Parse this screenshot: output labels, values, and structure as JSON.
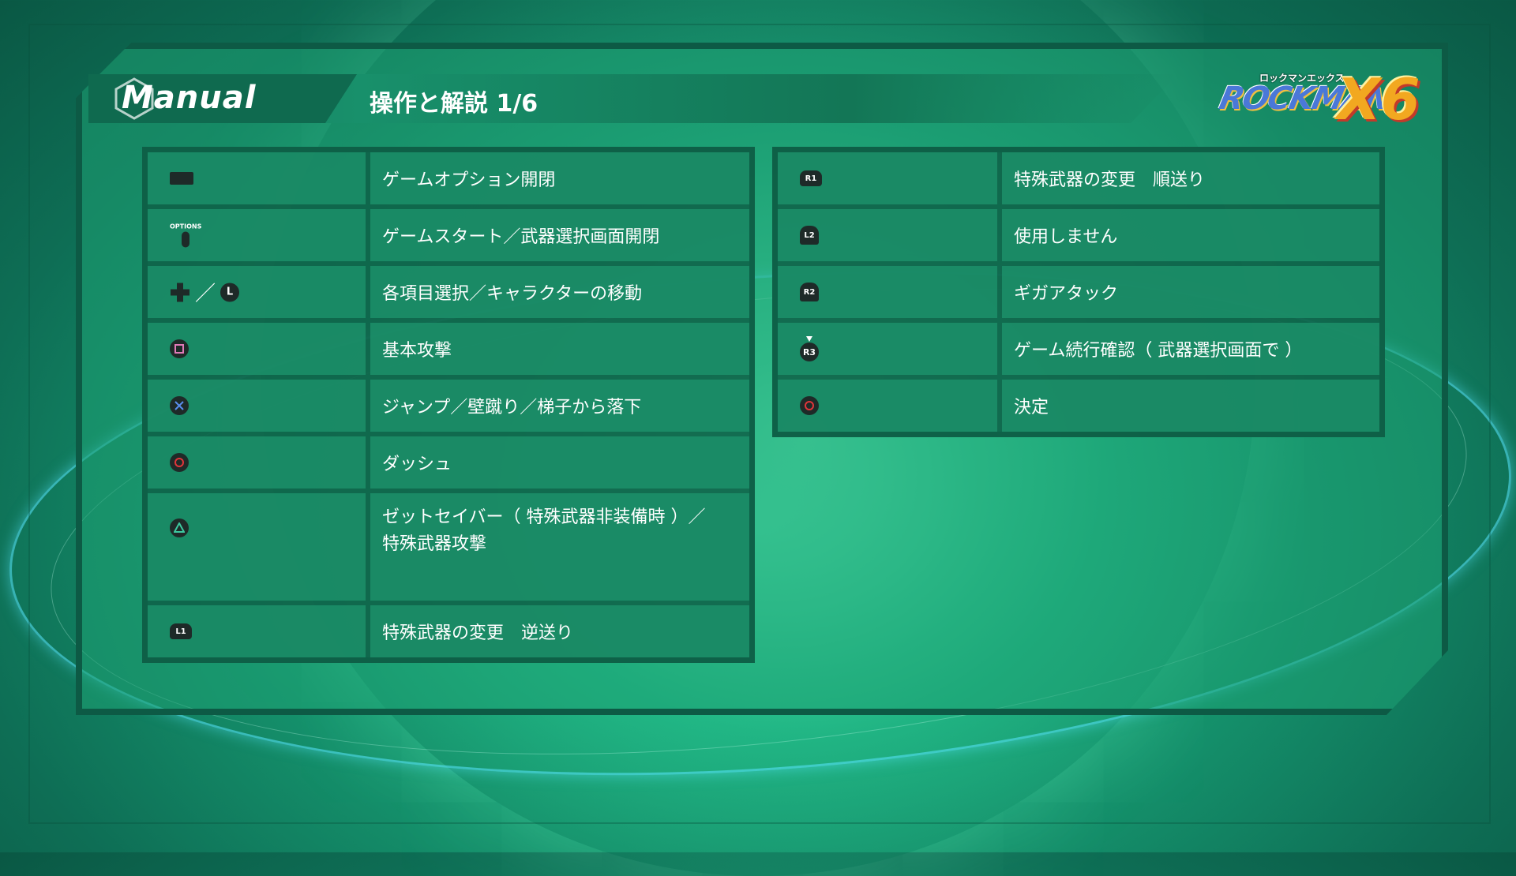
{
  "header": {
    "manual_label": "Manual",
    "page_title": "操作と解説 1/6"
  },
  "logo": {
    "kana": "ロックマンエックス",
    "rock": "ROCKMAN",
    "x6": "X6"
  },
  "left_table": [
    {
      "icon": "touchpad-icon",
      "text": "ゲームオプション開閉"
    },
    {
      "icon": "options-button-icon",
      "icon_label": "OPTIONS",
      "text": "ゲームスタート／武器選択画面開閉"
    },
    {
      "icon": "dpad-and-left-stick-icon",
      "icon_label": "L",
      "text": "各項目選択／キャラクターの移動"
    },
    {
      "icon": "square-button-icon",
      "text": "基本攻撃"
    },
    {
      "icon": "cross-button-icon",
      "text": "ジャンプ／壁蹴り／梯子から落下"
    },
    {
      "icon": "circle-button-icon",
      "text": "ダッシュ"
    },
    {
      "icon": "triangle-button-icon",
      "text_line1": "ゼットセイバー（ 特殊武器非装備時 ）／",
      "text_line2": "特殊武器攻撃"
    },
    {
      "icon": "l1-button-icon",
      "icon_label": "L1",
      "text": "特殊武器の変更　逆送り"
    }
  ],
  "right_table": [
    {
      "icon": "r1-button-icon",
      "icon_label": "R1",
      "text": "特殊武器の変更　順送り"
    },
    {
      "icon": "l2-button-icon",
      "icon_label": "L2",
      "text": "使用しません"
    },
    {
      "icon": "r2-button-icon",
      "icon_label": "R2",
      "text": "ギガアタック"
    },
    {
      "icon": "r3-button-icon",
      "icon_label": "R3",
      "text": "ゲーム続行確認（ 武器選択画面で ）"
    },
    {
      "icon": "circle-button-icon",
      "text": "決定"
    }
  ],
  "colors": {
    "circle": "#e0353a",
    "cross": "#5a8ef0",
    "square": "#e07ab8",
    "triangle": "#3ec9a0"
  }
}
